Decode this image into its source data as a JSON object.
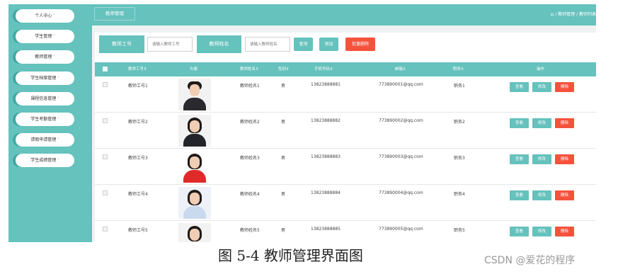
{
  "sidebar": {
    "items": [
      {
        "label": "个人中心"
      },
      {
        "label": "学生管理"
      },
      {
        "label": "教师管理"
      },
      {
        "label": "学生档案管理"
      },
      {
        "label": "课程信息管理"
      },
      {
        "label": "学生考勤管理"
      },
      {
        "label": "请假申请管理"
      },
      {
        "label": "学生成绩管理"
      }
    ],
    "caret": "˅"
  },
  "topbar": {
    "tab": "教师管理",
    "breadcrumb": "/ 教师管理 / 教师列表"
  },
  "search": {
    "label_id": "教师工号",
    "placeholder_id": "请输入教师工号",
    "label_name": "教师姓名",
    "placeholder_name": "请输入教师姓名",
    "query_label": "查询",
    "add_label": "添加",
    "batch_delete_label": "批量删除"
  },
  "table": {
    "headers": [
      "教师工号⇕",
      "头像",
      "教师姓名⇕",
      "性别⇕",
      "手机号码⇕",
      "邮箱⇕",
      "职务⇕",
      "操作"
    ],
    "rows": [
      {
        "id": "教师工号1",
        "name": "教师姓名1",
        "gender": "男",
        "phone": "13823888881",
        "email": "773890001@qq.com",
        "post": "职务1"
      },
      {
        "id": "教师工号2",
        "name": "教师姓名2",
        "gender": "男",
        "phone": "13823888882",
        "email": "773890002@qq.com",
        "post": "职务2"
      },
      {
        "id": "教师工号3",
        "name": "教师姓名3",
        "gender": "男",
        "phone": "13823888883",
        "email": "773890003@qq.com",
        "post": "职务3"
      },
      {
        "id": "教师工号4",
        "name": "教师姓名4",
        "gender": "男",
        "phone": "13823888884",
        "email": "773890004@qq.com",
        "post": "职务4"
      },
      {
        "id": "教师工号5",
        "name": "教师姓名5",
        "gender": "男",
        "phone": "13823888885",
        "email": "773890005@qq.com",
        "post": "职务5"
      }
    ],
    "actions": {
      "view": "查看",
      "edit": "修改",
      "delete": "删除"
    }
  },
  "caption": "图 5-4 教师管理界面图",
  "watermark": "CSDN @爱花的程序",
  "colors": {
    "accent": "#65c2bd",
    "danger": "#f5523c",
    "sidebar_shadow": "#3fa9a2"
  },
  "icons": {
    "home": "home-icon",
    "sort": "sort-icon",
    "caret": "chevron-down-icon"
  }
}
